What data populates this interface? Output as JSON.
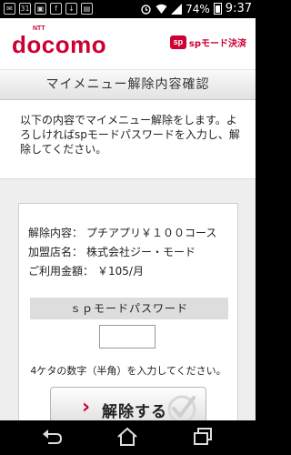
{
  "status_bar": {
    "notif_icons": [
      "mail-icon",
      "calendar-icon",
      "image-icon",
      "facebook-icon",
      "download-icon",
      "gallery-icon"
    ],
    "calendar_day": "31",
    "battery": "74%",
    "time": "9:37"
  },
  "header": {
    "logo_text": "docomo",
    "logo_ntt": "NTT",
    "sp_icon": "sp",
    "sp_text": "spモード決済"
  },
  "title": "マイメニュー解除内容確認",
  "message": "以下の内容でマイメニュー解除をします。よろしければspモードパスワードを入力し、解除してください。",
  "details": [
    {
      "label": "解除内容：",
      "value": "プチアプリ￥１００コース"
    },
    {
      "label": "加盟店名：",
      "value": "株式会社ジー・モード"
    },
    {
      "label": "ご利用金額：",
      "value": "￥105/月"
    }
  ],
  "password": {
    "label": "ｓｐモードパスワード",
    "value": "",
    "hint": "4ケタの数字（半角）を入力してください。"
  },
  "submit_label": "解除する",
  "colors": {
    "brand": "#cc0033"
  }
}
